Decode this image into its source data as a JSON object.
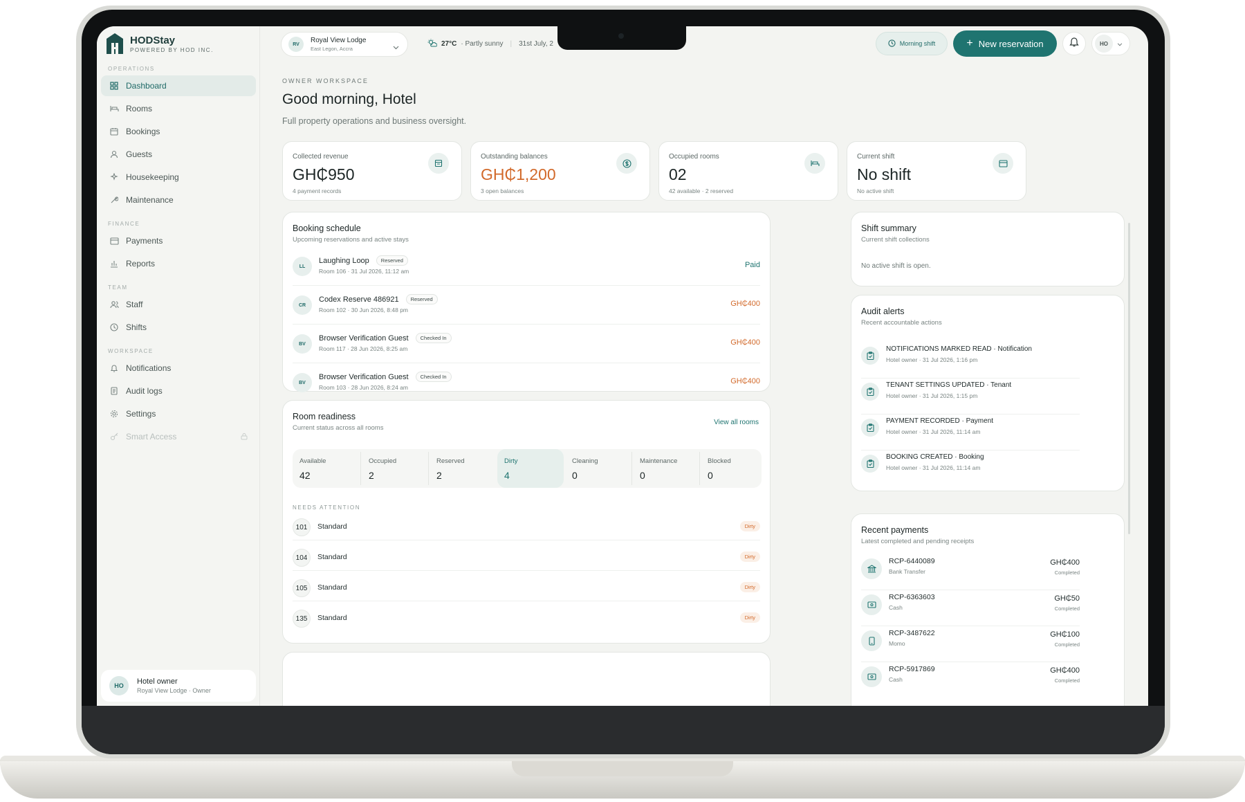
{
  "brand": {
    "name": "HODStay",
    "tagline": "POWERED BY HOD INC."
  },
  "sidebar": {
    "sections": [
      {
        "label": "OPERATIONS",
        "items": [
          {
            "label": "Dashboard",
            "icon": "grid-icon",
            "active": true
          },
          {
            "label": "Rooms",
            "icon": "bed-icon"
          },
          {
            "label": "Bookings",
            "icon": "calendar-icon"
          },
          {
            "label": "Guests",
            "icon": "user-icon"
          },
          {
            "label": "Housekeeping",
            "icon": "sparkle-icon"
          },
          {
            "label": "Maintenance",
            "icon": "wrench-icon"
          }
        ]
      },
      {
        "label": "FINANCE",
        "items": [
          {
            "label": "Payments",
            "icon": "card-icon"
          },
          {
            "label": "Reports",
            "icon": "bar-chart-icon"
          }
        ]
      },
      {
        "label": "TEAM",
        "items": [
          {
            "label": "Staff",
            "icon": "users-icon"
          },
          {
            "label": "Shifts",
            "icon": "clock-icon"
          }
        ]
      },
      {
        "label": "WORKSPACE",
        "items": [
          {
            "label": "Notifications",
            "icon": "bell-icon"
          },
          {
            "label": "Audit logs",
            "icon": "log-icon"
          },
          {
            "label": "Settings",
            "icon": "gear-icon"
          },
          {
            "label": "Smart Access",
            "icon": "key-icon",
            "locked": true
          }
        ]
      }
    ],
    "user": {
      "initials": "HO",
      "name": "Hotel owner",
      "sub": "Royal View Lodge · Owner"
    }
  },
  "topbar": {
    "property": {
      "initials": "RV",
      "name": "Royal View Lodge",
      "location": "East Legon, Accra"
    },
    "weather": {
      "temp": "27°C",
      "condition": "· Partly sunny",
      "date": "31st July, 2"
    },
    "shift_label": "Morning shift",
    "new_reservation": "New reservation",
    "account_initials": "HO"
  },
  "header": {
    "eyebrow": "OWNER WORKSPACE",
    "greeting": "Good morning, Hotel",
    "subtitle": "Full property operations and business oversight."
  },
  "stats": [
    {
      "label": "Collected revenue",
      "value": "GH₵950",
      "sub": "4 payment records",
      "icon": "receipt-icon"
    },
    {
      "label": "Outstanding balances",
      "value": "GH₵1,200",
      "sub": "3 open balances",
      "icon": "dollar-icon",
      "accent": "#d2692a"
    },
    {
      "label": "Occupied rooms",
      "value": "02",
      "sub": "42 available · 2 reserved",
      "icon": "bed-icon"
    },
    {
      "label": "Current shift",
      "value": "No shift",
      "sub": "No active shift",
      "icon": "card-icon"
    }
  ],
  "booking_schedule": {
    "title": "Booking schedule",
    "subtitle": "Upcoming reservations and active stays",
    "rows": [
      {
        "initials": "LL",
        "name": "Laughing Loop",
        "status": "Reserved",
        "detail": "Room 106 · 31 Jul 2026, 11:12 am",
        "amount": "Paid"
      },
      {
        "initials": "CR",
        "name": "Codex Reserve 486921",
        "status": "Reserved",
        "detail": "Room 102 · 30 Jun 2026, 8:48 pm",
        "amount": "GH₵400"
      },
      {
        "initials": "BV",
        "name": "Browser Verification Guest",
        "status": "Checked In",
        "detail": "Room 117 · 28 Jun 2026, 8:25 am",
        "amount": "GH₵400"
      },
      {
        "initials": "BV",
        "name": "Browser Verification Guest",
        "status": "Checked In",
        "detail": "Room 103 · 28 Jun 2026, 8:24 am",
        "amount": "GH₵400"
      }
    ]
  },
  "room_readiness": {
    "title": "Room readiness",
    "subtitle": "Current status across all rooms",
    "view_all": "View all rooms",
    "statuses": [
      {
        "label": "Available",
        "value": "42"
      },
      {
        "label": "Occupied",
        "value": "2"
      },
      {
        "label": "Reserved",
        "value": "2"
      },
      {
        "label": "Dirty",
        "value": "4"
      },
      {
        "label": "Cleaning",
        "value": "0"
      },
      {
        "label": "Maintenance",
        "value": "0"
      },
      {
        "label": "Blocked",
        "value": "0"
      }
    ],
    "attention_label": "NEEDS ATTENTION",
    "attention": [
      {
        "room": "101",
        "type": "Standard",
        "status": "Dirty"
      },
      {
        "room": "104",
        "type": "Standard",
        "status": "Dirty"
      },
      {
        "room": "105",
        "type": "Standard",
        "status": "Dirty"
      },
      {
        "room": "135",
        "type": "Standard",
        "status": "Dirty"
      }
    ]
  },
  "shift_summary": {
    "title": "Shift summary",
    "subtitle": "Current shift collections",
    "empty": "No active shift is open."
  },
  "audit_alerts": {
    "title": "Audit alerts",
    "subtitle": "Recent accountable actions",
    "rows": [
      {
        "title": "NOTIFICATIONS MARKED READ · Notification",
        "sub": "Hotel owner · 31 Jul 2026, 1:16 pm"
      },
      {
        "title": "TENANT SETTINGS UPDATED · Tenant",
        "sub": "Hotel owner · 31 Jul 2026, 1:15 pm"
      },
      {
        "title": "PAYMENT RECORDED · Payment",
        "sub": "Hotel owner · 31 Jul 2026, 11:14 am"
      },
      {
        "title": "BOOKING CREATED · Booking",
        "sub": "Hotel owner · 31 Jul 2026, 11:14 am"
      }
    ]
  },
  "recent_payments": {
    "title": "Recent payments",
    "subtitle": "Latest completed and pending receipts",
    "rows": [
      {
        "id": "RCP-6440089",
        "method": "Bank Transfer",
        "amount": "GH₵400",
        "status": "Completed",
        "icon": "bank-icon"
      },
      {
        "id": "RCP-6363603",
        "method": "Cash",
        "amount": "GH₵50",
        "status": "Completed",
        "icon": "cash-icon"
      },
      {
        "id": "RCP-3487622",
        "method": "Momo",
        "amount": "GH₵100",
        "status": "Completed",
        "icon": "phone-icon"
      },
      {
        "id": "RCP-5917869",
        "method": "Cash",
        "amount": "GH₵400",
        "status": "Completed",
        "icon": "cash-icon"
      }
    ]
  }
}
